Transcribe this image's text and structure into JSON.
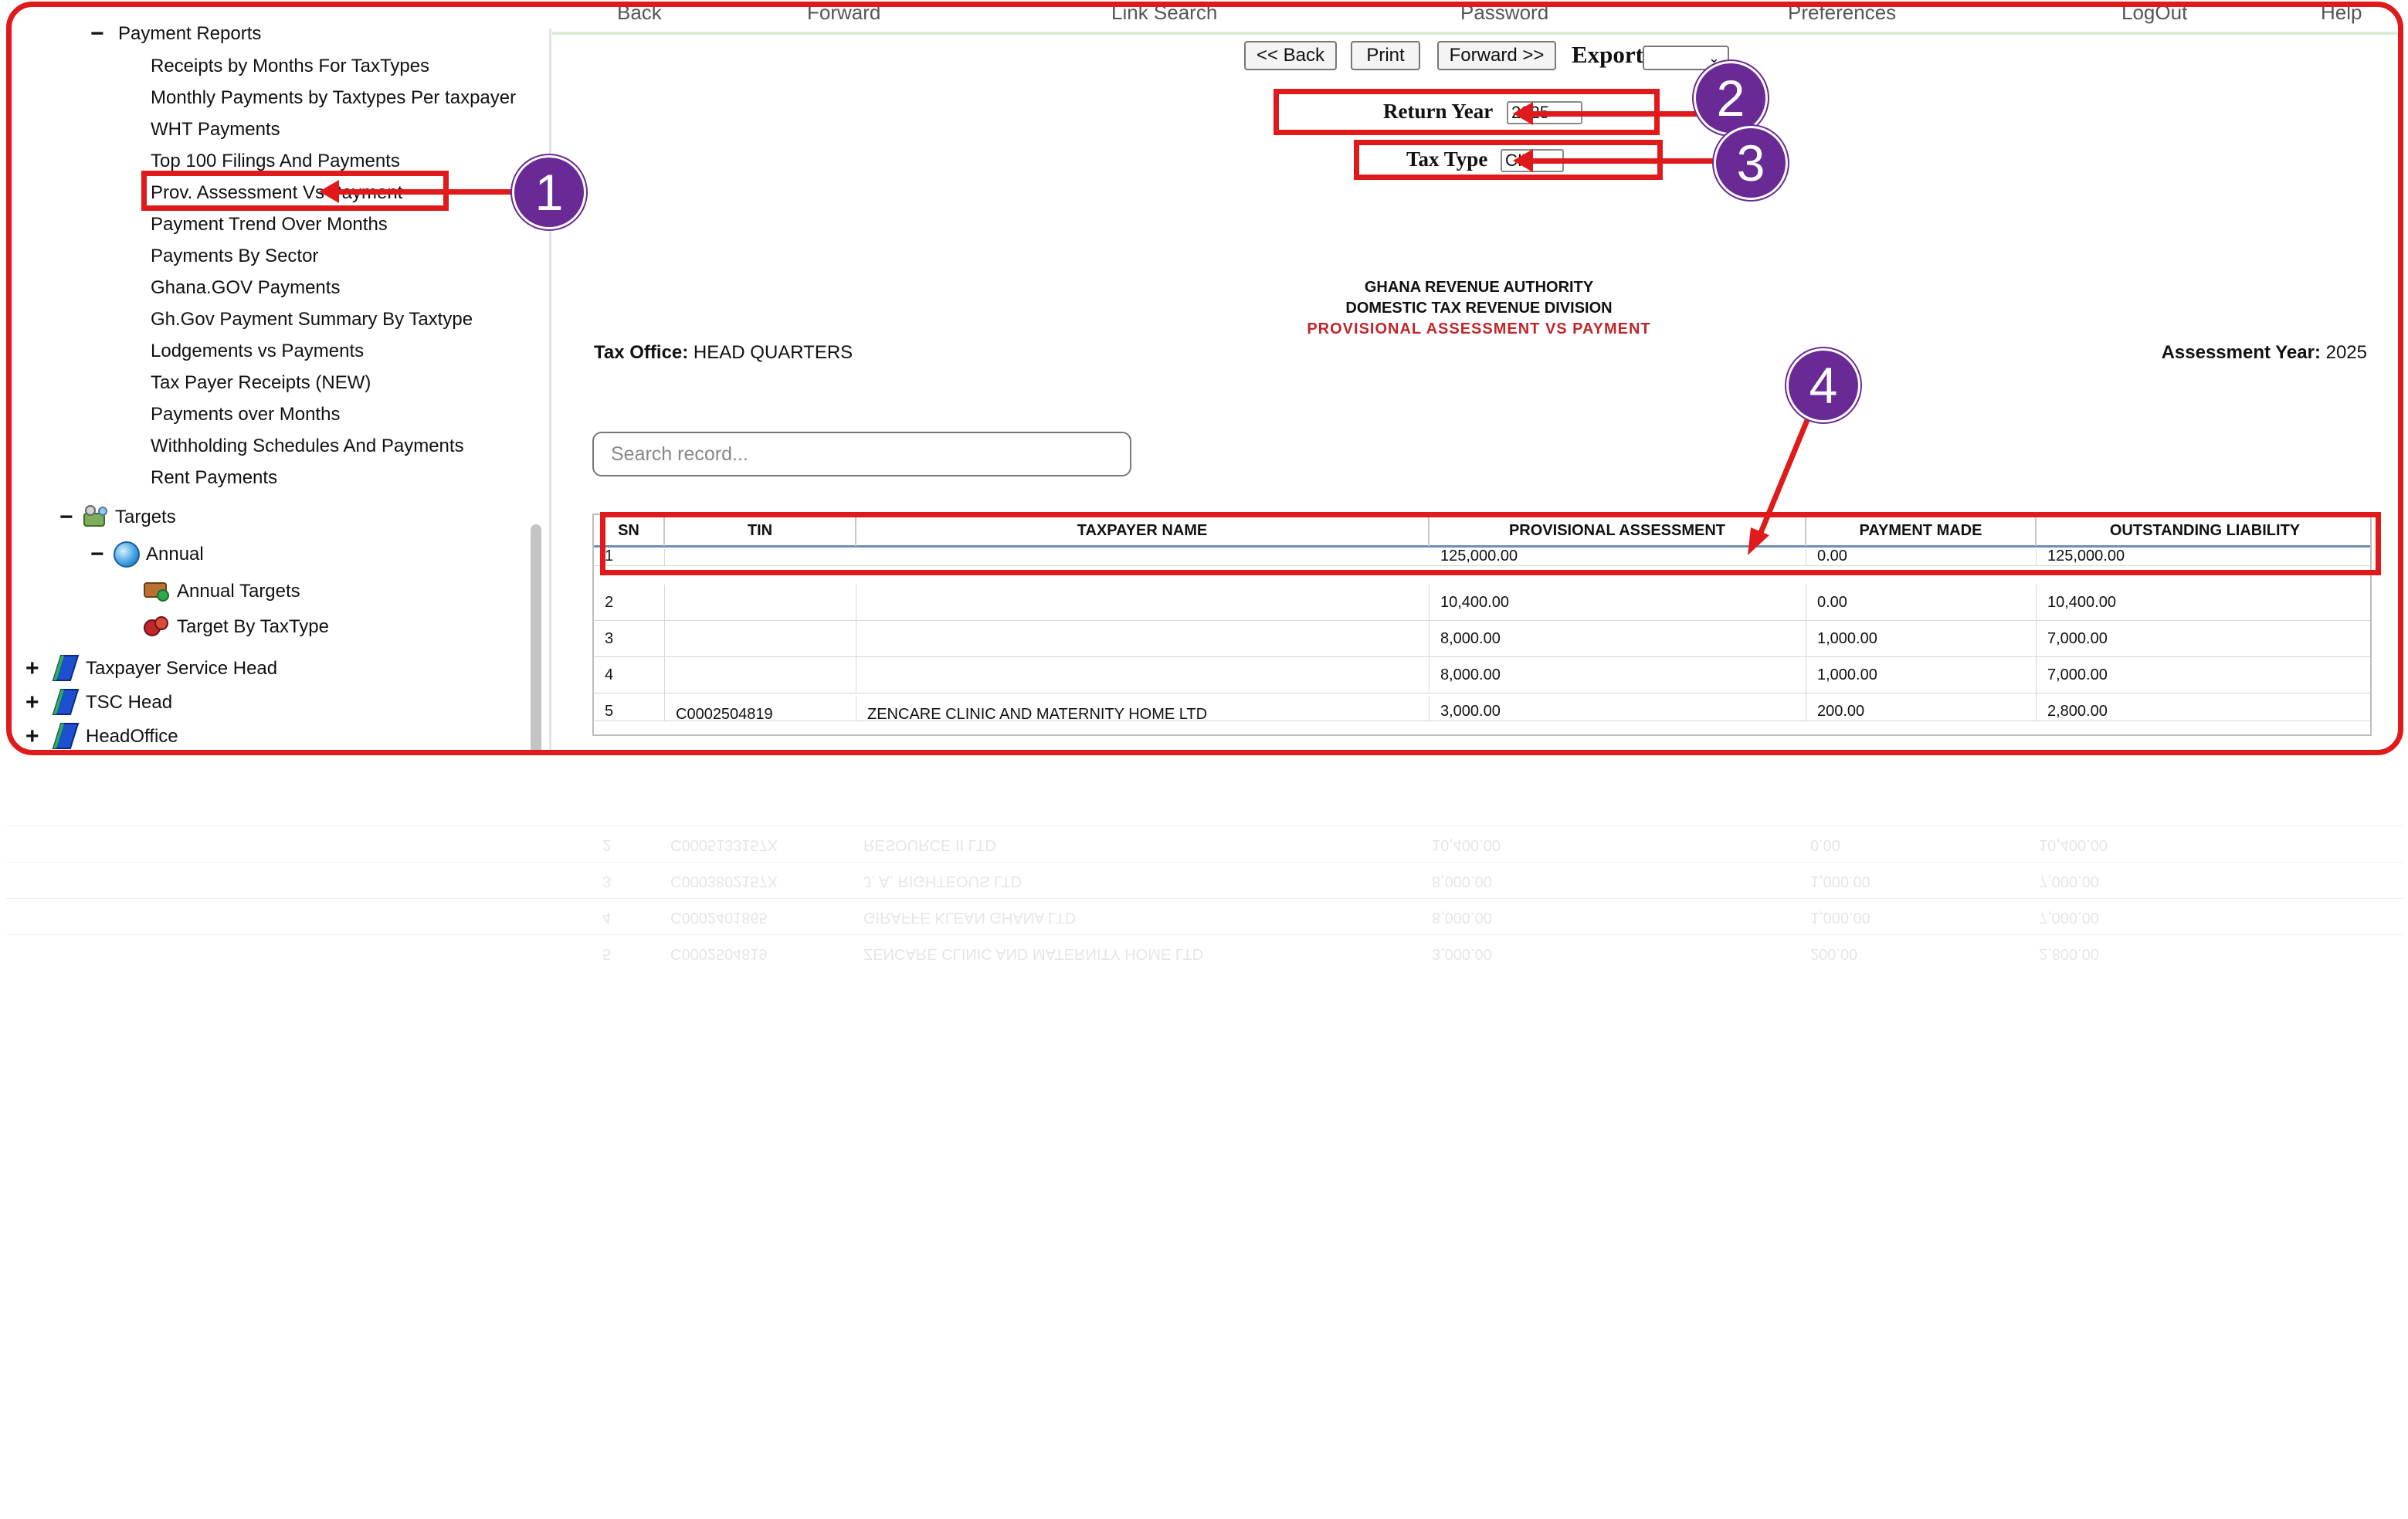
{
  "sidebar": {
    "payment_reports_label": "Payment Reports",
    "reports": [
      "Receipts by Months For TaxTypes",
      "Monthly Payments by Taxtypes Per taxpayer",
      "WHT Payments",
      "Top 100 Filings And Payments",
      "Prov. Assessment Vs Payment",
      "Payment Trend Over Months",
      "Payments By Sector",
      "Ghana.GOV Payments",
      "Gh.Gov Payment Summary By Taxtype",
      "Lodgements vs Payments",
      "Tax Payer Receipts (NEW)",
      "Payments over Months",
      "Withholding Schedules And Payments",
      "Rent Payments"
    ],
    "targets_label": "Targets",
    "annual_label": "Annual",
    "annual_targets_label": "Annual Targets",
    "target_by_taxtype_label": "Target By TaxType",
    "groups": [
      "Taxpayer Service Head",
      "TSC Head",
      "HeadOffice"
    ],
    "toggle_minus": "−",
    "toggle_plus": "+"
  },
  "topnav": [
    "Back",
    "Forward",
    "Link Search",
    "Password",
    "Preferences",
    "LogOut",
    "Help"
  ],
  "toolbar": {
    "back_label": "<< Back",
    "print_label": "Print",
    "forward_label": "Forward >>",
    "export_label": "Export",
    "export_value": "",
    "chevron": "⌄"
  },
  "params": {
    "return_year_label": "Return Year",
    "return_year_value": "2025",
    "tax_type_label": "Tax Type",
    "tax_type_value": "CIT"
  },
  "report": {
    "org": "GHANA REVENUE AUTHORITY",
    "division": "DOMESTIC TAX REVENUE DIVISION",
    "title": "PROVISIONAL ASSESSMENT VS PAYMENT",
    "tax_office_label": "Tax Office:",
    "tax_office_value": "HEAD QUARTERS",
    "assessment_year_label": "Assessment Year:",
    "assessment_year_value": "2025"
  },
  "search": {
    "placeholder": "Search record..."
  },
  "table": {
    "headers": [
      "SN",
      "TIN",
      "TAXPAYER NAME",
      "PROVISIONAL ASSESSMENT",
      "PAYMENT MADE",
      "OUTSTANDING LIABILITY"
    ],
    "rows": [
      {
        "sn": "2",
        "tin": "",
        "name": "",
        "assessment": "10,400.00",
        "payment": "0.00",
        "outstanding": "10,400.00"
      },
      {
        "sn": "3",
        "tin": "",
        "name": "",
        "assessment": "8,000.00",
        "payment": "1,000.00",
        "outstanding": "7,000.00"
      },
      {
        "sn": "4",
        "tin": "",
        "name": "",
        "assessment": "8,000.00",
        "payment": "1,000.00",
        "outstanding": "7,000.00"
      },
      {
        "sn": "5",
        "tin": "C0002504819",
        "name": "ZENCARE CLINIC AND MATERNITY HOME LTD",
        "assessment": "3,000.00",
        "payment": "200.00",
        "outstanding": "2,800.00"
      }
    ],
    "partial_row": {
      "sn": "1",
      "assessment": "125,000.00",
      "payment": "0.00",
      "outstanding": "125,000.00"
    }
  },
  "annotations": {
    "badge1": "1",
    "badge2": "2",
    "badge3": "3",
    "badge4": "4"
  },
  "reflection": {
    "rows": [
      {
        "sn": "5",
        "tin": "C0002504819",
        "name": "ZENCARE CLINIC AND MATERNITY HOME LTD",
        "assessment": "3,000.00",
        "payment": "200.00",
        "outstanding": "2,800.00"
      },
      {
        "sn": "4",
        "tin": "C0002401865",
        "name": "GIRAFFE KLEAN GHANA LTD",
        "assessment": "8,000.00",
        "payment": "1,000.00",
        "outstanding": "7,000.00"
      },
      {
        "sn": "3",
        "tin": "C0003802157X",
        "name": "J. A. RIGHTEOUS LTD",
        "assessment": "8,000.00",
        "payment": "1,000.00",
        "outstanding": "7,000.00"
      },
      {
        "sn": "2",
        "tin": "C0005133157X",
        "name": "RESOURCE II LTD",
        "assessment": "10,400.00",
        "payment": "0.00",
        "outstanding": "10,400.00"
      }
    ]
  },
  "colors": {
    "highlight": "#e01a1a",
    "badge": "#6a2a96",
    "report_title": "#c0262b",
    "header_rule": "#6e8fb3"
  }
}
